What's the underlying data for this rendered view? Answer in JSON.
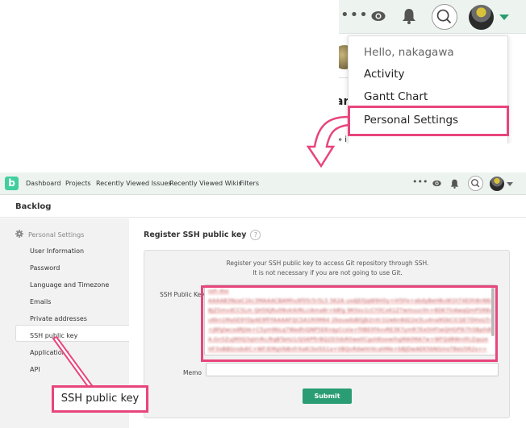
{
  "top_header": {
    "icons": [
      "more-dots-icon",
      "watch-eye-icon",
      "notification-bell-icon",
      "search-icon",
      "user-avatar",
      "caret-down-icon"
    ],
    "more_label": "•••",
    "partial_text": "ar",
    "partial_text2": "» i"
  },
  "user_menu": {
    "greeting": "Hello, nakagawa",
    "items": [
      {
        "label": "Activity"
      },
      {
        "label": "Gantt Chart"
      },
      {
        "label": "Personal Settings",
        "highlighted": true
      }
    ]
  },
  "app": {
    "logo_letter": "b",
    "nav": {
      "items": [
        {
          "label": "Dashboard"
        },
        {
          "label": "Projects"
        },
        {
          "label": "Recently Viewed Issues"
        },
        {
          "label": "Recently Viewed Wikis"
        },
        {
          "label": "Filters"
        }
      ],
      "more_label": "•••"
    },
    "space_title": "Backlog",
    "sidebar": {
      "section_label": "Personal Settings",
      "items": [
        {
          "label": "User Information"
        },
        {
          "label": "Password"
        },
        {
          "label": "Language and Timezone"
        },
        {
          "label": "Emails"
        },
        {
          "label": "Private addresses"
        },
        {
          "label": "SSH public key",
          "active": true
        },
        {
          "label": "Applications"
        },
        {
          "label": "API"
        }
      ]
    },
    "main": {
      "heading": "Register SSH public key",
      "help_icon": "?",
      "description_line1": "Register your SSH public key to access Git repository through SSH.",
      "description_line2": "It is not necessary if you are not going to use Git.",
      "ssh_key_label": "SSH Public Key",
      "ssh_key_lines": [
        "ssh-dss",
        "AAAAB3NzaC1kc3MAAACBAMhu9f05r5r5L5 5K2A uxdjE0jqW9H0y+Hl5Fe+abdyBeH8uW1hT4E0h8nN6xkS",
        "BJZ5mvdCC5Lm QH5KjRu0NvkikIRLciAma8r+b8lg 9K0ov1cCY0CxK1Z7wmuuc0n+8DK7lnAwqQmP5R8vGwW",
        "u6kn1MaSE9YDp4E9fFFAAAAFQCSA1R0M64 2bsuadsB0jJb2nXr1Uwbn8d22e3Lu4na9GbCiCQE7DHxU3+QeHZ",
        "+J8fglwcodRJVe+C5ym9bLq7WadhiQNP5EKnqyCcsla+f0BE0f4vvRE3K7ymR7Ee5HFtwQHGP9i7h5Bp0dbfhW",
        "A.Gn5ZujM0Q3qVnRc/RqBTaHz1/QS6PftrBQ2D3dsR0we0CgoldtoowihgMA0MA7w+WFQd8Wn0fcZqsze",
        "HF3oBBGnsbdiC+WF/EMgVbBnfrXaKi3oI5S1a+VBQvRdwHrHcaHMe+bBJDwAEK5bNGmsT8eU5R2s=="
      ],
      "memo_label": "Memo",
      "memo_value": "",
      "submit_label": "Submit"
    }
  },
  "annotations": {
    "callout_label": "SSH public key",
    "highlight_color": "#e8457c"
  },
  "colors": {
    "accent_green": "#2a9d74",
    "logo_green": "#42ce9f",
    "nav_bg": "#edf4f0",
    "sidebar_bg": "#f2f2f2",
    "annotation_pink": "#e8457c"
  }
}
